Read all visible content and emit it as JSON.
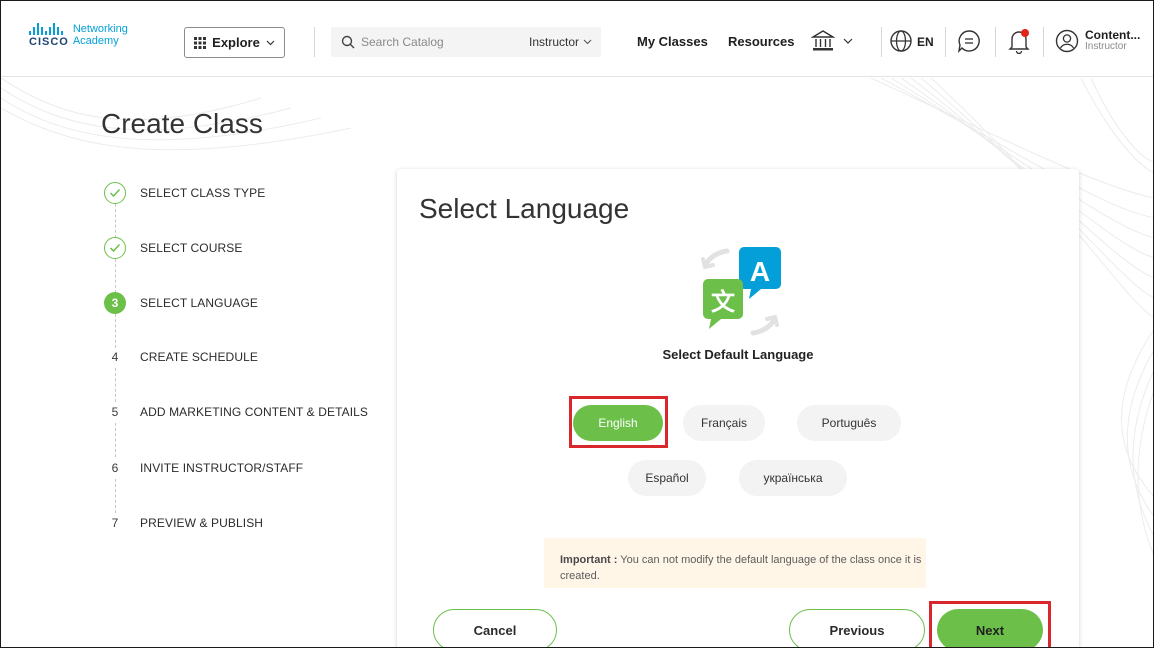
{
  "header": {
    "logo": {
      "line1": "Networking",
      "line2": "Academy",
      "brand": "CISCO"
    },
    "explore_label": "Explore",
    "search_placeholder": "Search Catalog",
    "role_select": "Instructor",
    "nav": {
      "my_classes": "My Classes",
      "resources": "Resources"
    },
    "language_code": "EN",
    "user": {
      "name": "Content...",
      "role": "Instructor"
    },
    "icons": [
      "grid-icon",
      "search-icon",
      "institution-icon",
      "globe-icon",
      "chat-icon",
      "bell-icon",
      "user-avatar-icon"
    ]
  },
  "page": {
    "title": "Create Class"
  },
  "stepper": {
    "steps": [
      {
        "marker": "",
        "label": "SELECT CLASS TYPE",
        "state": "complete"
      },
      {
        "marker": "",
        "label": "SELECT COURSE",
        "state": "complete"
      },
      {
        "marker": "3",
        "label": "SELECT LANGUAGE",
        "state": "current"
      },
      {
        "marker": "4",
        "label": "CREATE SCHEDULE",
        "state": "pending"
      },
      {
        "marker": "5",
        "label": "ADD MARKETING CONTENT & DETAILS",
        "state": "pending"
      },
      {
        "marker": "6",
        "label": "INVITE INSTRUCTOR/STAFF",
        "state": "pending"
      },
      {
        "marker": "7",
        "label": "PREVIEW & PUBLISH",
        "state": "pending"
      }
    ]
  },
  "card": {
    "title": "Select Language",
    "graphic": {
      "glyph_a": "A",
      "glyph_b": "文"
    },
    "subtitle": "Select Default Language",
    "languages": [
      {
        "label": "English",
        "selected": true
      },
      {
        "label": "Français",
        "selected": false
      },
      {
        "label": "Português",
        "selected": false
      },
      {
        "label": "Español",
        "selected": false
      },
      {
        "label": "українська",
        "selected": false
      }
    ],
    "notice": {
      "strong": "Important :",
      "text": " You can not modify the default language of the class once it is created."
    },
    "buttons": {
      "cancel": "Cancel",
      "previous": "Previous",
      "next": "Next"
    }
  },
  "colors": {
    "accent_green": "#6cc04a",
    "highlight_red": "#d9272e",
    "cisco_blue": "#049fd9",
    "notice_bg": "#fff6e8"
  }
}
